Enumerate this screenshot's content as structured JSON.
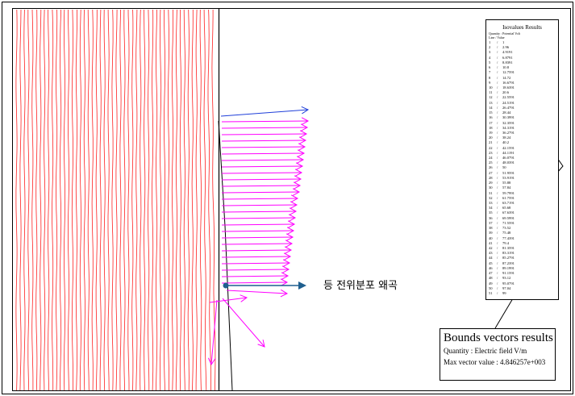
{
  "annotation": "등 전위분포 왜곡",
  "isovalues": {
    "title": "Isovalues Results",
    "quantity": "Quantity : Potential Volt",
    "header": "Line / Value",
    "rows": [
      [
        "1",
        "1"
      ],
      [
        "2",
        "2.96"
      ],
      [
        "3",
        "4.9191"
      ],
      [
        "4",
        "6.8791"
      ],
      [
        "5",
        "8.8391"
      ],
      [
        "6",
        "10.8"
      ],
      [
        "7",
        "12.7591"
      ],
      [
        "8",
        "14.72"
      ],
      [
        "9",
        "16.6791"
      ],
      [
        "10",
        "18.6391"
      ],
      [
        "11",
        "20.6"
      ],
      [
        "12",
        "22.5591"
      ],
      [
        "13",
        "24.5191"
      ],
      [
        "14",
        "26.4791"
      ],
      [
        "15",
        "28.44"
      ],
      [
        "16",
        "30.3991"
      ],
      [
        "17",
        "32.3591"
      ],
      [
        "18",
        "34.3191"
      ],
      [
        "19",
        "36.2791"
      ],
      [
        "20",
        "38.24"
      ],
      [
        "21",
        "40.2"
      ],
      [
        "22",
        "42.1591"
      ],
      [
        "23",
        "44.1191"
      ],
      [
        "24",
        "46.0791"
      ],
      [
        "25",
        "48.0391"
      ],
      [
        "26",
        "50"
      ],
      [
        "27",
        "51.9591"
      ],
      [
        "28",
        "53.9191"
      ],
      [
        "29",
        "55.88"
      ],
      [
        "30",
        "57.84"
      ],
      [
        "31",
        "59.7991"
      ],
      [
        "32",
        "61.7591"
      ],
      [
        "33",
        "63.7191"
      ],
      [
        "34",
        "65.68"
      ],
      [
        "35",
        "67.6391"
      ],
      [
        "36",
        "69.5991"
      ],
      [
        "37",
        "71.5591"
      ],
      [
        "38",
        "73.52"
      ],
      [
        "39",
        "75.48"
      ],
      [
        "40",
        "77.4391"
      ],
      [
        "41",
        "79.4"
      ],
      [
        "42",
        "81.3591"
      ],
      [
        "43",
        "83.3191"
      ],
      [
        "44",
        "85.2791"
      ],
      [
        "45",
        "87.2391"
      ],
      [
        "46",
        "89.1991"
      ],
      [
        "47",
        "91.1591"
      ],
      [
        "48",
        "93.12"
      ],
      [
        "49",
        "95.0791"
      ],
      [
        "50",
        "97.04"
      ],
      [
        "51",
        "99"
      ]
    ]
  },
  "bounds": {
    "title": "Bounds vectors results",
    "quantity": "Quantity : Electric field V/m",
    "max": "Max vector value : 4.846257e+003"
  },
  "colors": {
    "isoline": "#ff2020",
    "vector": "#ff00ff",
    "top_vector": "#1f3fd9",
    "annot_arrow": "#1f5f8f"
  }
}
